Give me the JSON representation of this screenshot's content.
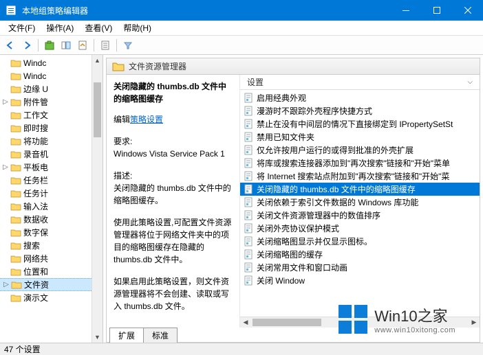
{
  "window": {
    "title": "本地组策略编辑器"
  },
  "menu": {
    "file": "文件(F)",
    "action": "操作(A)",
    "view": "查看(V)",
    "help": "帮助(H)"
  },
  "tree": {
    "items": [
      {
        "label": "Windc",
        "exp": ""
      },
      {
        "label": "Windc",
        "exp": ""
      },
      {
        "label": "边缘 U",
        "exp": ""
      },
      {
        "label": "附件管",
        "exp": "▷"
      },
      {
        "label": "工作文",
        "exp": ""
      },
      {
        "label": "即时搜",
        "exp": ""
      },
      {
        "label": "将功能",
        "exp": ""
      },
      {
        "label": "录音机",
        "exp": ""
      },
      {
        "label": "平板电",
        "exp": "▷"
      },
      {
        "label": "任务栏",
        "exp": ""
      },
      {
        "label": "任务计",
        "exp": ""
      },
      {
        "label": "输入法",
        "exp": ""
      },
      {
        "label": "数据收",
        "exp": ""
      },
      {
        "label": "数字保",
        "exp": ""
      },
      {
        "label": "搜索",
        "exp": ""
      },
      {
        "label": "网络共",
        "exp": ""
      },
      {
        "label": "位置和",
        "exp": ""
      },
      {
        "label": "文件资",
        "exp": "▷",
        "sel": true
      },
      {
        "label": "演示文",
        "exp": ""
      }
    ]
  },
  "header": {
    "title": "文件资源管理器"
  },
  "desc": {
    "policy_title": "关闭隐藏的 thumbs.db 文件中的缩略图缓存",
    "edit_label_prefix": "编辑",
    "edit_link": "策略设置",
    "req_label": "要求:",
    "req_value": "Windows Vista Service Pack 1",
    "desc_label": "描述:",
    "desc_p1": "关闭隐藏的 thumbs.db 文件中的缩略图缓存。",
    "desc_p2": "使用此策略设置,可配置文件资源管理器将位于网络文件夹中的项目的缩略图缓存在隐藏的 thumbs.db 文件中。",
    "desc_p3": "如果启用此策略设置，则文件资源管理器将不会创建、读取或写入 thumbs.db 文件。"
  },
  "list": {
    "col_header": "设置",
    "items": [
      "启用经典外观",
      "漫游时不跟踪外壳程序快捷方式",
      "禁止在没有中间层的情况下直接绑定到 IPropertySetSt",
      "禁用已知文件夹",
      "仅允许按用户运行的或得到批准的外壳扩展",
      "将库或搜索连接器添加到\"再次搜索\"链接和\"开始\"菜单",
      "将 Internet 搜索站点附加到\"再次搜索\"链接和\"开始\"菜",
      "关闭隐藏的 thumbs.db 文件中的缩略图缓存",
      "关闭依赖于索引文件数据的 Windows 库功能",
      "关闭文件资源管理器中的数值排序",
      "关闭外壳协议保护模式",
      "关闭缩略图显示并仅显示图标。",
      "关闭缩略图的缓存",
      "关闭常用文件和窗口动画",
      "关闭 Window"
    ],
    "selected_index": 7
  },
  "tabs": {
    "extended": "扩展",
    "standard": "标准"
  },
  "status": {
    "text": "47 个设置"
  },
  "watermark": {
    "big": "Win10之家",
    "small": "www.win10xitong.com"
  }
}
